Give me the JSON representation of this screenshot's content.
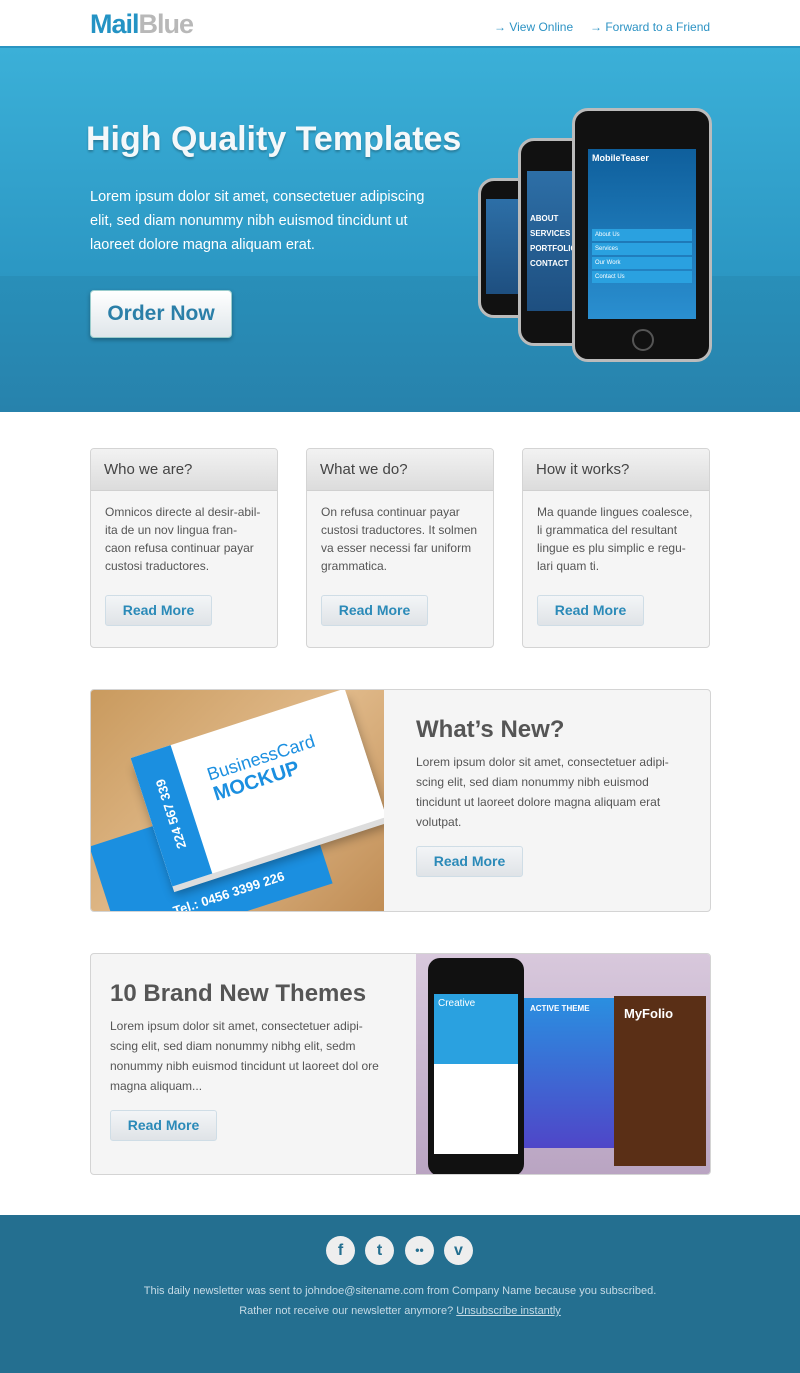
{
  "header": {
    "logo_part1": "Mail",
    "logo_part2": "Blue",
    "links": [
      {
        "label": "View Online",
        "icon": "arrow-right-icon"
      },
      {
        "label": "Forward to a Friend",
        "icon": "arrow-right-icon"
      }
    ]
  },
  "hero": {
    "title": "High Quality Templates",
    "text": "Lorem ipsum dolor sit amet, consectetuer adipiscing elit, sed diam nonummy nibh euismod tincidunt ut laoreet dolore magna aliquam erat.",
    "button": "Order Now",
    "phone_screen": "MobileTeaser",
    "phone_menu": [
      "About Us",
      "Services",
      "Our Work",
      "Contact Us"
    ],
    "phone2_menu": [
      "ABOUT",
      "SERVICES",
      "PORTFOLIO",
      "CONTACT"
    ]
  },
  "features": [
    {
      "title": "Who we are?",
      "text": "Omnicos directe al desir-abil-ita de un nov lingua fran-caon refusa continuar payar custosi traductores.",
      "button": "Read More"
    },
    {
      "title": "What we do?",
      "text": "On refusa continuar payar custosi traductores. It solmen va esser necessi far uniform grammatica.",
      "button": "Read More"
    },
    {
      "title": "How it works?",
      "text": "Ma quande lingues coalesce, li grammatica del resultant lingue es plu simplic e regu-lari quam ti.",
      "button": "Read More"
    }
  ],
  "whats_new": {
    "title": "What’s New?",
    "text": "Lorem ipsum dolor sit amet, consectetuer adipi-scing elit, sed diam nonummy nibh euismod tincidunt ut laoreet dolore magna aliquam erat volutpat.",
    "button": "Read More",
    "card_title": "BusinessCard",
    "card_sub": "MOCKUP",
    "card_phone": "224 567 339",
    "card_tel": "Tel.: 0456 3399 226"
  },
  "themes": {
    "title": "10 Brand New Themes",
    "text": "Lorem ipsum dolor sit amet, consectetuer adipi-scing elit, sed diam nonummy nibhg elit, sedm nonummy nibh euismod tincidunt ut laoreet dol ore magna aliquam...",
    "button": "Read More",
    "img_labels": [
      "Creative",
      "ACTIVE THEME",
      "MyFolio"
    ]
  },
  "footer": {
    "social": [
      {
        "name": "facebook",
        "glyph": "f"
      },
      {
        "name": "twitter",
        "glyph": "t"
      },
      {
        "name": "flickr",
        "glyph": "••"
      },
      {
        "name": "vimeo",
        "glyph": "v"
      }
    ],
    "line1": "This daily newsletter was sent to johndoe@sitename.com from Company Name because you subscribed.",
    "line2": "Rather not receive our newsletter anymore?",
    "unsubscribe": "Unsubscribe instantly"
  }
}
